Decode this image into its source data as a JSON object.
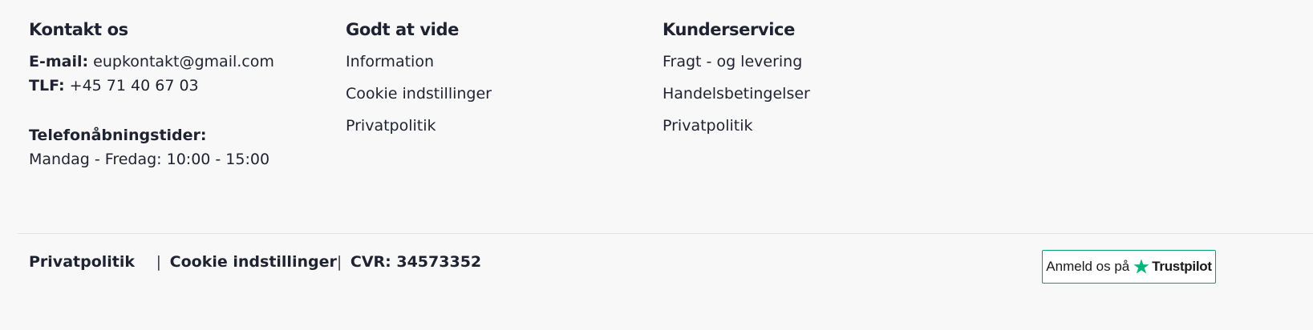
{
  "contact": {
    "title": "Kontakt os",
    "email_label": "E-mail:",
    "email_value": "eupkontakt@gmail.com",
    "phone_label": "TLF:",
    "phone_value": "+45 71 40 67 03",
    "hours_label": "Telefonåbningstider:",
    "hours_value": "Mandag - Fredag: 10:00 - 15:00"
  },
  "good_to_know": {
    "title": "Godt at vide",
    "links": [
      "Information",
      "Cookie indstillinger",
      "Privatpolitik"
    ]
  },
  "customer_service": {
    "title": "Kunderservice",
    "links": [
      "Fragt - og levering",
      "Handelsbetingelser",
      "Privatpolitik"
    ]
  },
  "bottom": {
    "privacy_link": "Privatpolitik",
    "separator": "|",
    "cookie_link": "Cookie indstillinger",
    "cvr_separator": "|",
    "cvr": "CVR: 34573352"
  },
  "trustpilot": {
    "text": "Anmeld os på",
    "brand": "Trustpilot",
    "icon": "star-icon",
    "accent_color": "#00b67a",
    "border_color": "#04a06f"
  },
  "colors": {
    "text": "#1f2230",
    "background": "#f8f8f8"
  }
}
